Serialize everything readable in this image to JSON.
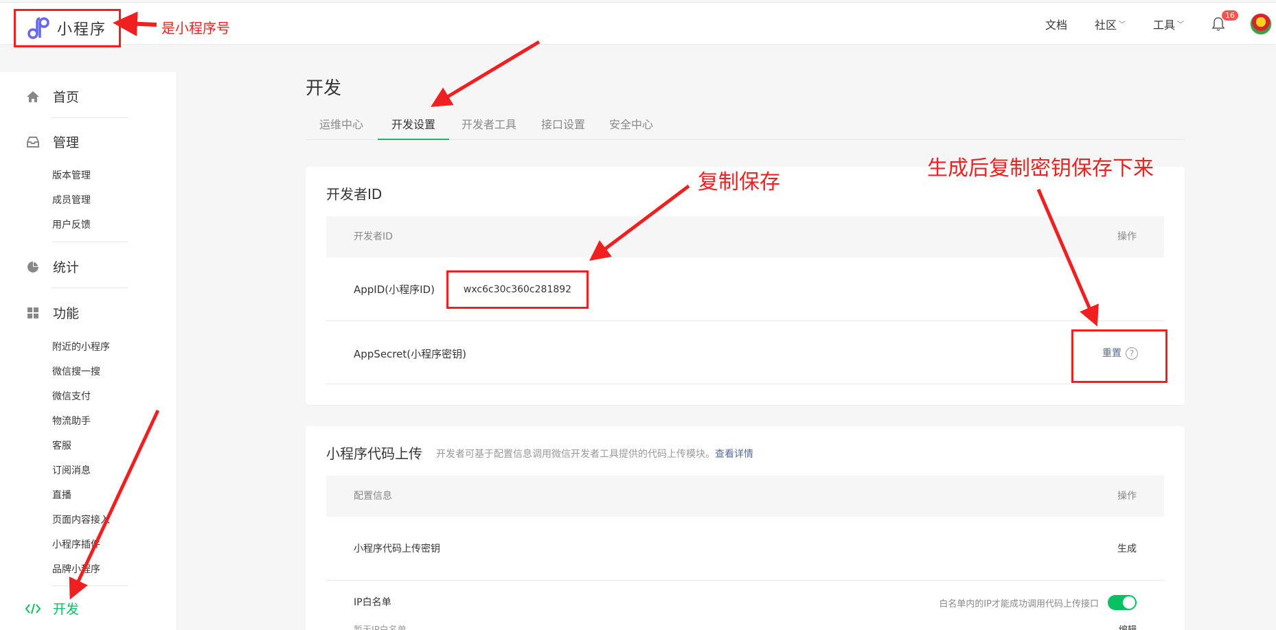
{
  "header": {
    "logo_text": "小程序",
    "links": [
      {
        "label": "文档",
        "dropdown": false
      },
      {
        "label": "社区",
        "dropdown": true
      },
      {
        "label": "工具",
        "dropdown": true
      }
    ],
    "notification_count": "16"
  },
  "sidebar": {
    "home": "首页",
    "manage": "管理",
    "manage_items": [
      "版本管理",
      "成员管理",
      "用户反馈"
    ],
    "stats": "统计",
    "features": "功能",
    "feature_items": [
      "附近的小程序",
      "微信搜一搜",
      "微信支付",
      "物流助手",
      "客服",
      "订阅消息",
      "直播",
      "页面内容接入",
      "小程序插件",
      "品牌小程序"
    ],
    "develop": "开发"
  },
  "main": {
    "title": "开发",
    "tabs": [
      "运维中心",
      "开发设置",
      "开发者工具",
      "接口设置",
      "安全中心"
    ],
    "active_tab": "开发设置",
    "dev_id_card": {
      "title": "开发者ID",
      "col_name": "开发者ID",
      "col_action": "操作",
      "appid_label": "AppID(小程序ID)",
      "appid_value": "wxc6c30c360c281892",
      "secret_label": "AppSecret(小程序密钥)",
      "secret_action": "重置",
      "help_icon": "?"
    },
    "upload_card": {
      "title": "小程序代码上传",
      "desc": "开发者可基于配置信息调用微信开发者工具提供的代码上传模块。",
      "desc_link": "查看详情",
      "col_name": "配置信息",
      "col_action": "操作",
      "key_label": "小程序代码上传密钥",
      "key_action": "生成",
      "ip_label": "IP白名单",
      "ip_hint": "白名单内的IP才能成功调用代码上传接口",
      "ip_sub": "暂无IP白名单",
      "ip_action": "编辑",
      "toggle_on": true
    }
  },
  "annotations": {
    "logo_note": "是小程序号",
    "copy_note": "复制保存",
    "secret_note": "生成后复制密钥保存下来"
  },
  "colors": {
    "brand_green": "#07c160",
    "link_blue": "#576b95",
    "annotation_red": "#f02020",
    "badge_red": "#fa5151"
  }
}
